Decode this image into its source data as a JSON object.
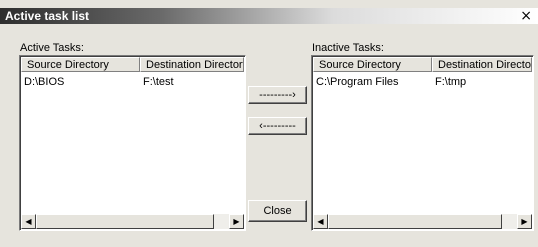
{
  "window": {
    "title": "Active task list",
    "close_glyph": "×"
  },
  "active": {
    "label": "Active Tasks:",
    "columns": [
      "Source Directory",
      "Destination Directory"
    ],
    "rows": [
      [
        "D:\\BIOS",
        "F:\\test"
      ]
    ]
  },
  "inactive": {
    "label": "Inactive Tasks:",
    "columns": [
      "Source Directory",
      "Destination Directory"
    ],
    "rows": [
      [
        "C:\\Program Files",
        "F:\\tmp"
      ]
    ]
  },
  "buttons": {
    "move_right": "---------›",
    "move_left": "‹---------",
    "close": "Close"
  },
  "scroll": {
    "left_arrow": "◀",
    "right_arrow": "▶"
  }
}
